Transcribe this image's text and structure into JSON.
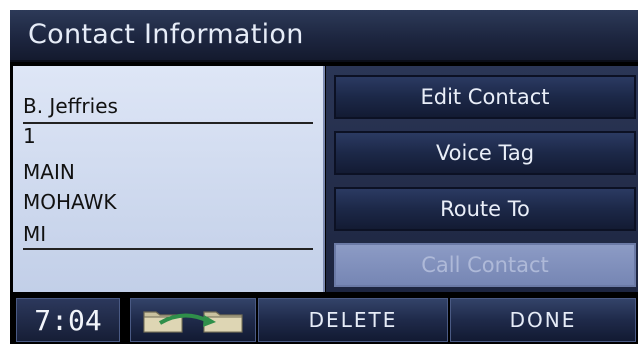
{
  "title": "Contact Information",
  "contact": {
    "name": "B. Jeffries",
    "lines": [
      "1",
      "MAIN",
      "MOHAWK",
      "MI"
    ]
  },
  "menu": {
    "edit_contact": "Edit Contact",
    "voice_tag": "Voice Tag",
    "route_to": "Route To",
    "call_contact": "Call Contact"
  },
  "bottom": {
    "time": "7:04",
    "folder_icon": "folder-transfer-icon",
    "delete": "DELETE",
    "done": "DONE"
  },
  "colors": {
    "accent": "#1d2848",
    "disabled": "#7f8fbf",
    "info_bg": "#d2dcef",
    "arrow": "#2f8f4a"
  }
}
